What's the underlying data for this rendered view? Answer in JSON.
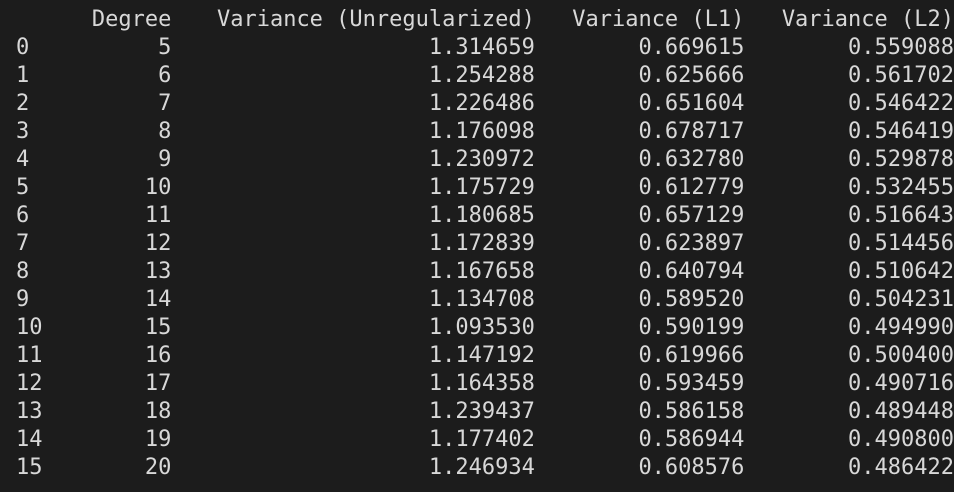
{
  "columns": {
    "index": "",
    "degree": "Degree",
    "unregularized": "Variance (Unregularized)",
    "l1": "Variance (L1)",
    "l2": "Variance (L2)"
  },
  "rows": [
    {
      "index": "0",
      "degree": "5",
      "unregularized": "1.314659",
      "l1": "0.669615",
      "l2": "0.559088"
    },
    {
      "index": "1",
      "degree": "6",
      "unregularized": "1.254288",
      "l1": "0.625666",
      "l2": "0.561702"
    },
    {
      "index": "2",
      "degree": "7",
      "unregularized": "1.226486",
      "l1": "0.651604",
      "l2": "0.546422"
    },
    {
      "index": "3",
      "degree": "8",
      "unregularized": "1.176098",
      "l1": "0.678717",
      "l2": "0.546419"
    },
    {
      "index": "4",
      "degree": "9",
      "unregularized": "1.230972",
      "l1": "0.632780",
      "l2": "0.529878"
    },
    {
      "index": "5",
      "degree": "10",
      "unregularized": "1.175729",
      "l1": "0.612779",
      "l2": "0.532455"
    },
    {
      "index": "6",
      "degree": "11",
      "unregularized": "1.180685",
      "l1": "0.657129",
      "l2": "0.516643"
    },
    {
      "index": "7",
      "degree": "12",
      "unregularized": "1.172839",
      "l1": "0.623897",
      "l2": "0.514456"
    },
    {
      "index": "8",
      "degree": "13",
      "unregularized": "1.167658",
      "l1": "0.640794",
      "l2": "0.510642"
    },
    {
      "index": "9",
      "degree": "14",
      "unregularized": "1.134708",
      "l1": "0.589520",
      "l2": "0.504231"
    },
    {
      "index": "10",
      "degree": "15",
      "unregularized": "1.093530",
      "l1": "0.590199",
      "l2": "0.494990"
    },
    {
      "index": "11",
      "degree": "16",
      "unregularized": "1.147192",
      "l1": "0.619966",
      "l2": "0.500400"
    },
    {
      "index": "12",
      "degree": "17",
      "unregularized": "1.164358",
      "l1": "0.593459",
      "l2": "0.490716"
    },
    {
      "index": "13",
      "degree": "18",
      "unregularized": "1.239437",
      "l1": "0.586158",
      "l2": "0.489448"
    },
    {
      "index": "14",
      "degree": "19",
      "unregularized": "1.177402",
      "l1": "0.586944",
      "l2": "0.490800"
    },
    {
      "index": "15",
      "degree": "20",
      "unregularized": "1.246934",
      "l1": "0.608576",
      "l2": "0.486422"
    }
  ],
  "colors": {
    "background": "#1c1c1c",
    "text": "#d8d8d8"
  }
}
